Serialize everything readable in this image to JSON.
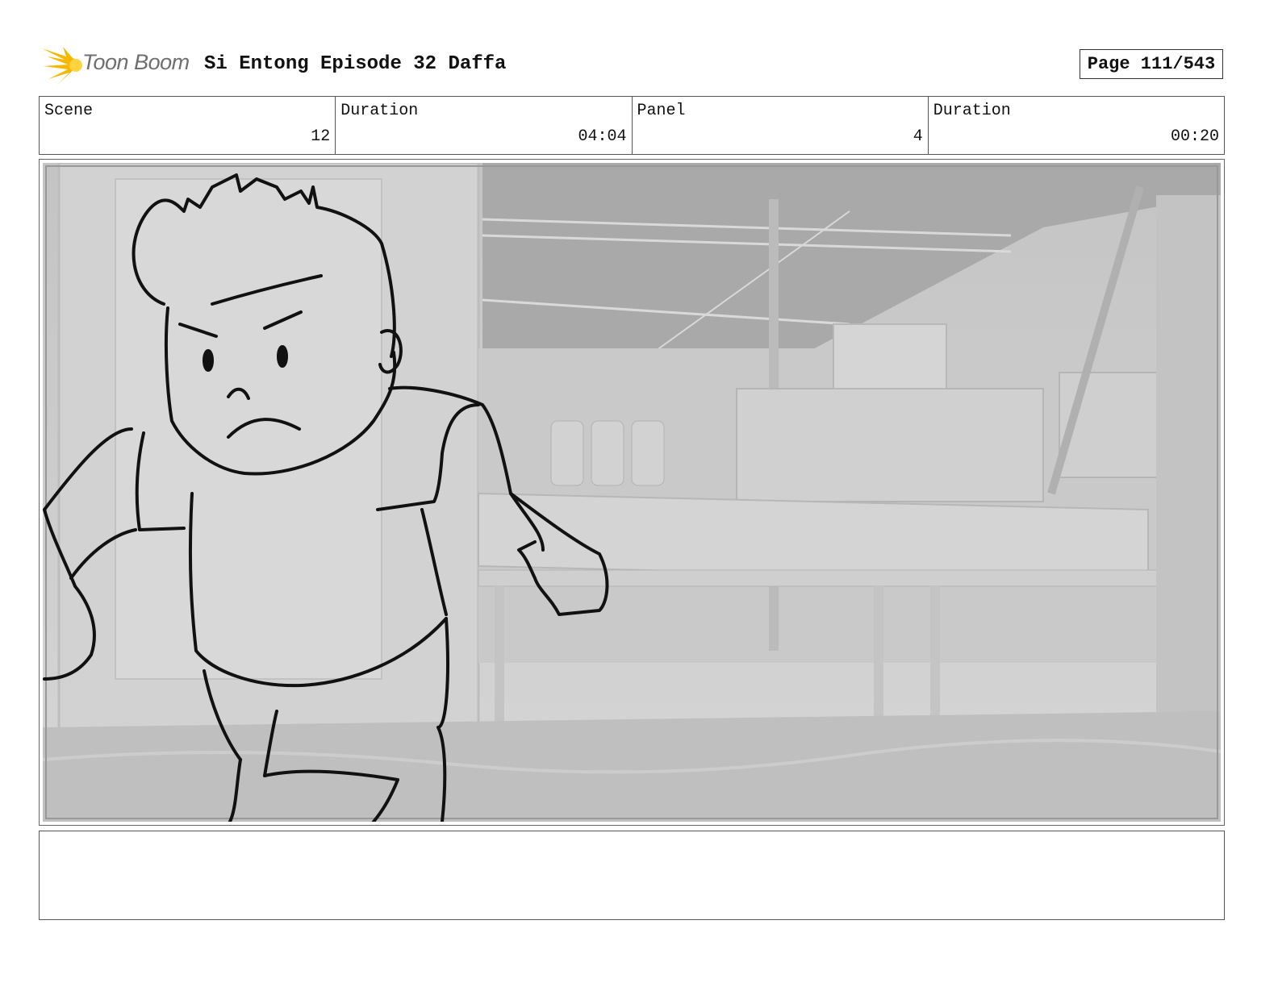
{
  "header": {
    "logo_text": "Toon Boom",
    "title": "Si Entong Episode 32 Daffa",
    "page_label": "Page 111/543"
  },
  "info": [
    {
      "label": "Scene",
      "value": "12"
    },
    {
      "label": "Duration",
      "value": "04:04"
    },
    {
      "label": "Panel",
      "value": "4"
    },
    {
      "label": "Duration",
      "value": "00:20"
    }
  ],
  "panel": {
    "icon": "storyboard-sketch-image",
    "description_visible": false
  },
  "notes": {
    "text": ""
  },
  "colors": {
    "logo_burst": "#f5b800",
    "logo_text": "#6f6f6f",
    "sketch_line": "#111111",
    "background_gray": "#c9c9c9"
  }
}
